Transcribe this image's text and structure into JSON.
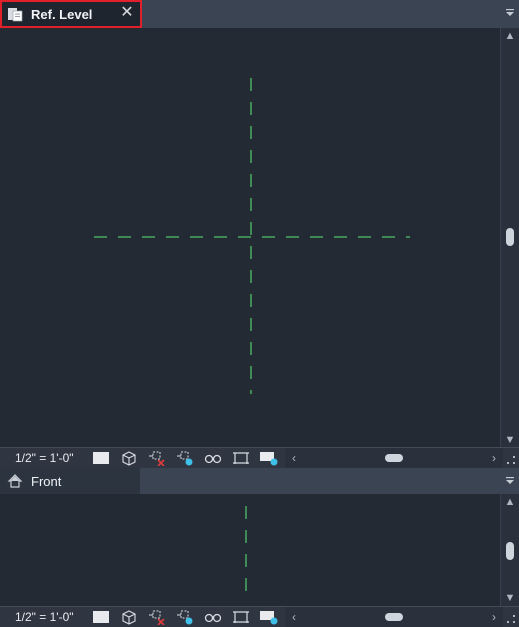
{
  "views": [
    {
      "title": "Ref. Level",
      "close_label": "✕",
      "scale": "1/2\" = 1'-0\"",
      "active": true
    },
    {
      "title": "Front",
      "scale": "1/2\" = 1'-0\"",
      "active": false
    }
  ],
  "colors": {
    "background": "#232a34",
    "reference_line": "#4ec06a",
    "active_outline": "#e0202a"
  },
  "icons": {
    "tab_ref_level": "sheet-view-icon",
    "tab_front": "elevation-house-icon",
    "tools": [
      "detail-level-icon",
      "3d-box-icon",
      "hide-isolate-icon",
      "reveal-hidden-icon",
      "temporary-view-icon",
      "crop-view-icon",
      "visual-style-icon"
    ]
  }
}
